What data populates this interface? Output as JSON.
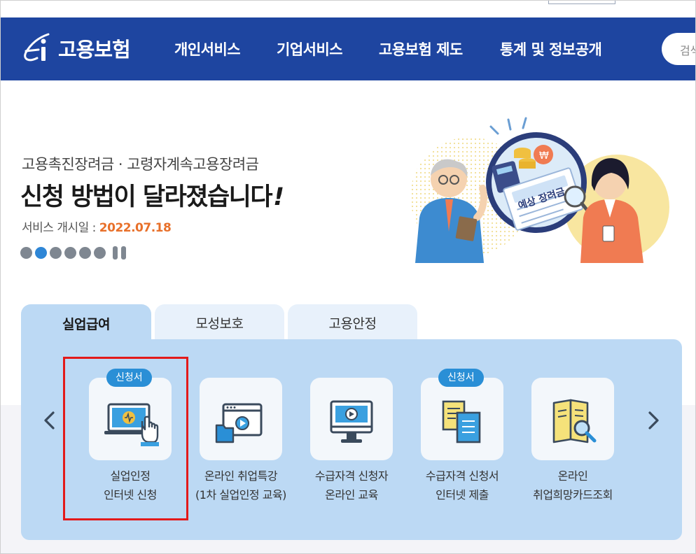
{
  "header": {
    "logo_text": "고용보험",
    "nav": [
      "개인서비스",
      "기업서비스",
      "고용보험 제도",
      "통계 및 정보공개"
    ],
    "search_placeholder": "검색"
  },
  "hero": {
    "subtitle": "고용촉진장려금 · 고령자계속고용장려금",
    "title": "신청 방법이 달라졌습니다",
    "title_suffix": "!",
    "date_label": "서비스 개시일 : ",
    "date_value": "2022.07.18",
    "illustration_text": "예상 장려금",
    "slide_count": 6,
    "active_slide": 2
  },
  "tabs": [
    {
      "label": "실업급여",
      "active": true
    },
    {
      "label": "모성보호",
      "active": false
    },
    {
      "label": "고용안정",
      "active": false
    }
  ],
  "cards": [
    {
      "badge": "신청서",
      "line1": "실업인정",
      "line2": "인터넷 신청",
      "icon": "laptop-pointer-icon",
      "highlighted": true
    },
    {
      "badge": null,
      "line1": "온라인 취업특강",
      "line2": "(1차 실업인정 교육)",
      "icon": "video-lecture-icon"
    },
    {
      "badge": null,
      "line1": "수급자격 신청자",
      "line2": "온라인 교육",
      "icon": "monitor-play-icon"
    },
    {
      "badge": "신청서",
      "line1": "수급자격 신청서",
      "line2": "인터넷 제출",
      "icon": "documents-icon"
    },
    {
      "badge": null,
      "line1": "온라인",
      "line2": "취업희망카드조회",
      "icon": "card-search-icon"
    }
  ],
  "colors": {
    "header_bg": "#1e45a0",
    "accent": "#2e86d6",
    "date": "#e8702a",
    "panel": "#bcd9f4",
    "highlight_box": "#e31a1a"
  }
}
